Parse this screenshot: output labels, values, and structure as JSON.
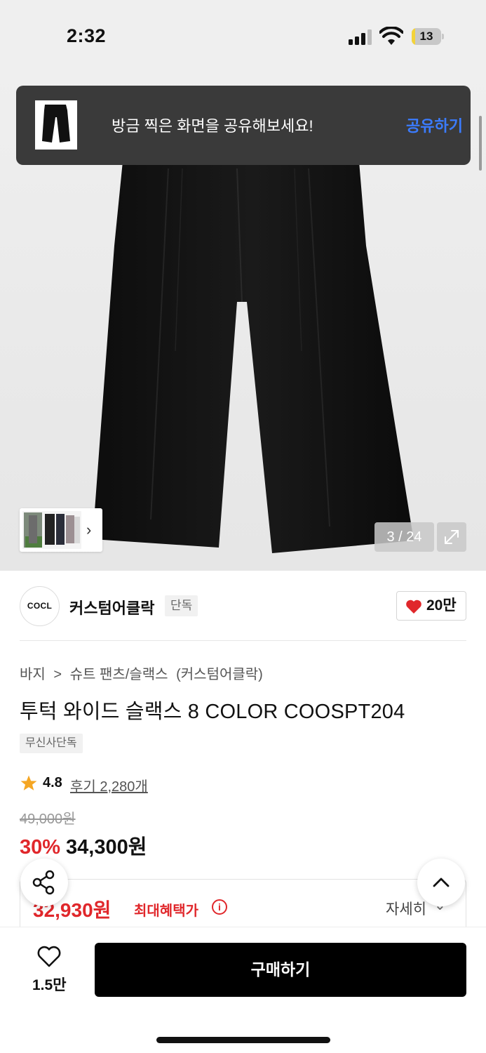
{
  "status_bar": {
    "time": "2:32",
    "battery": "13",
    "battery_level": 0.13
  },
  "toast": {
    "message": "방금 찍은 화면을 공유해보세요!",
    "action": "공유하기"
  },
  "gallery": {
    "counter": "3 / 24",
    "expand_icon": "expand-icon",
    "thumbnail_next_icon": "chevron-right-icon"
  },
  "brand": {
    "logo_text": "COCL",
    "name": "커스텀어클락",
    "badge": "단독",
    "likes": "20만"
  },
  "breadcrumb": [
    "바지",
    ">",
    "슈트 팬츠/슬랙스",
    "(커스텀어클락)"
  ],
  "product": {
    "title": "투턱 와이드 슬랙스 8 COLOR COOSPT204",
    "tag": "무신사단독",
    "rating": "4.8",
    "review_link": "후기 2,280개",
    "original_price": "49,000원",
    "discount": "30%",
    "sale_price": "34,300원"
  },
  "benefit": {
    "price": "32,930원",
    "label": "최대혜택가",
    "info_icon": "i",
    "detail": "자세히"
  },
  "floating": {
    "share_icon": "share-icon",
    "scroll_top_icon": "chevron-up-icon"
  },
  "bottom": {
    "wish_count": "1.5만",
    "buy_label": "구매하기"
  },
  "colors": {
    "accent_red": "#e0272b",
    "link_blue": "#3b7cff",
    "star": "#f5a623"
  }
}
